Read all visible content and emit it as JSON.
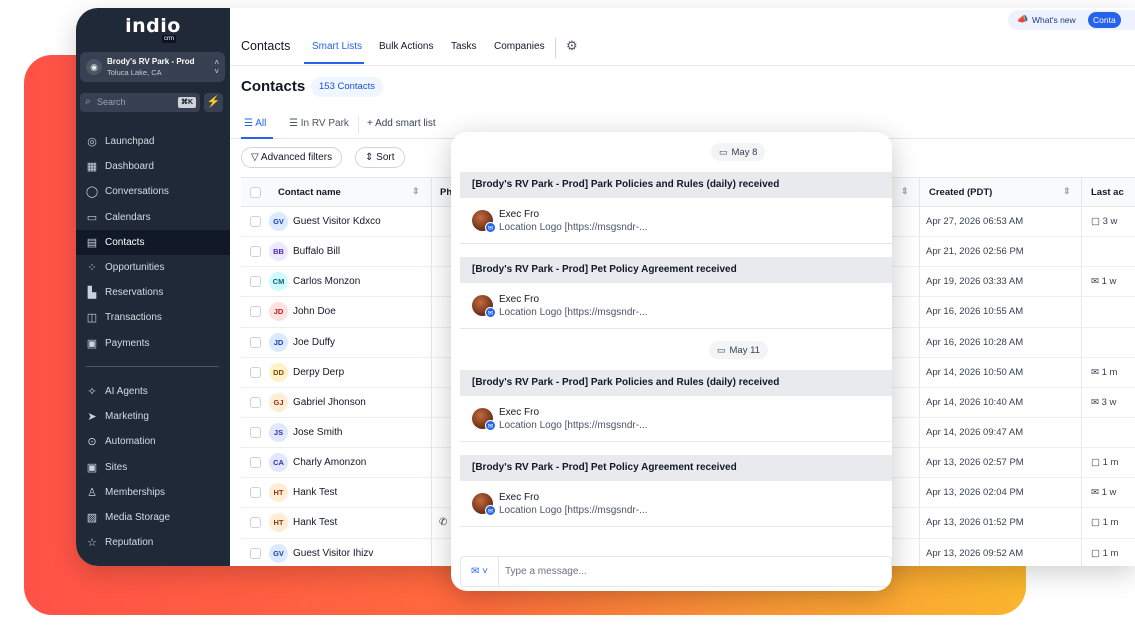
{
  "brand": {
    "logo_text": "indio",
    "logo_sub": "crm"
  },
  "location": {
    "name": "Brody's RV Park - Prod",
    "city": "Toluca Lake, CA"
  },
  "search": {
    "placeholder": "Search",
    "shortcut": "⌘K"
  },
  "sidebar": {
    "items": [
      {
        "label": "Launchpad",
        "icon": "rocket-icon",
        "glyph": "◎"
      },
      {
        "label": "Dashboard",
        "icon": "dashboard-icon",
        "glyph": "▦"
      },
      {
        "label": "Conversations",
        "icon": "chat-bubble-icon",
        "glyph": "◯"
      },
      {
        "label": "Calendars",
        "icon": "calendar-icon",
        "glyph": "▭"
      },
      {
        "label": "Contacts",
        "icon": "contacts-icon",
        "glyph": "▤",
        "active": true
      },
      {
        "label": "Opportunities",
        "icon": "opportunities-icon",
        "glyph": "⁘"
      },
      {
        "label": "Reservations",
        "icon": "reservations-icon",
        "glyph": "▙"
      },
      {
        "label": "Transactions",
        "icon": "transactions-icon",
        "glyph": "◫"
      },
      {
        "label": "Payments",
        "icon": "payments-icon",
        "glyph": "▣"
      }
    ],
    "items2": [
      {
        "label": "AI Agents",
        "icon": "sparkle-icon",
        "glyph": "✧"
      },
      {
        "label": "Marketing",
        "icon": "send-icon",
        "glyph": "➤"
      },
      {
        "label": "Automation",
        "icon": "automation-icon",
        "glyph": "⊙"
      },
      {
        "label": "Sites",
        "icon": "sites-icon",
        "glyph": "▣"
      },
      {
        "label": "Memberships",
        "icon": "membership-icon",
        "glyph": "♙"
      },
      {
        "label": "Media Storage",
        "icon": "media-icon",
        "glyph": "▨"
      },
      {
        "label": "Reputation",
        "icon": "star-icon",
        "glyph": "☆"
      }
    ]
  },
  "topnav": {
    "title": "Contacts",
    "tabs": [
      "Smart Lists",
      "Bulk Actions",
      "Tasks",
      "Companies"
    ],
    "whats_new": "What's new",
    "contact_btn": "Conta"
  },
  "page": {
    "title": "Contacts",
    "count": "153 Contacts"
  },
  "list_tabs": {
    "all": "All",
    "in_rv_park": "In RV Park",
    "add": "Add smart list"
  },
  "filters": {
    "advanced": "Advanced filters",
    "sort": "Sort"
  },
  "table": {
    "headers": {
      "name": "Contact name",
      "phone": "Ph",
      "created": "Created (PDT)",
      "last": "Last ac"
    },
    "rows": [
      {
        "initials": "GV",
        "name": "Guest Visitor Kdxco",
        "created": "Apr 27, 2026 06:53 AM",
        "last": "3 w",
        "last_icon": "chat"
      },
      {
        "initials": "BB",
        "name": "Buffalo Bill",
        "created": "Apr 21, 2026 02:56 PM",
        "last": "",
        "last_icon": ""
      },
      {
        "initials": "CM",
        "name": "Carlos Monzon",
        "created": "Apr 19, 2026 03:33 AM",
        "last": "1 w",
        "last_icon": "mail"
      },
      {
        "initials": "JD",
        "name": "John Doe",
        "created": "Apr 16, 2026 10:55 AM",
        "last": "",
        "last_icon": ""
      },
      {
        "initials": "JD",
        "name": "Joe Duffy",
        "created": "Apr 16, 2026 10:28 AM",
        "last": "",
        "last_icon": ""
      },
      {
        "initials": "DD",
        "name": "Derpy Derp",
        "created": "Apr 14, 2026 10:50 AM",
        "last": "1 m",
        "last_icon": "mail"
      },
      {
        "initials": "GJ",
        "name": "Gabriel Jhonson",
        "created": "Apr 14, 2026 10:40 AM",
        "last": "3 w",
        "last_icon": "mail"
      },
      {
        "initials": "JS",
        "name": "Jose Smith",
        "created": "Apr 14, 2026 09:47 AM",
        "last": "",
        "last_icon": ""
      },
      {
        "initials": "CA",
        "name": "Charly Amonzon",
        "created": "Apr 13, 2026 02:57 PM",
        "last": "1 m",
        "last_icon": "chat"
      },
      {
        "initials": "HT",
        "name": "Hank Test",
        "created": "Apr 13, 2026 02:04 PM",
        "last": "1 w",
        "last_icon": "mail"
      },
      {
        "initials": "HT",
        "name": "Hank Test",
        "created": "Apr 13, 2026 01:52 PM",
        "last": "1 m",
        "last_icon": "chat",
        "phone_icon": true
      },
      {
        "initials": "GV",
        "name": "Guest Visitor Ihizv",
        "created": "Apr 13, 2026 09:52 AM",
        "last": "1 m",
        "last_icon": "chat"
      }
    ]
  },
  "avatar_colors": {
    "GV": [
      "#dbeafe",
      "#1e40af"
    ],
    "BB": [
      "#ede9fe",
      "#5b21b6"
    ],
    "CM": [
      "#cffafe",
      "#155e75"
    ],
    "JD1": [
      "#fee2e2",
      "#b91c1c"
    ],
    "JD2": [
      "#dbeafe",
      "#1e40af"
    ],
    "DD": [
      "#fef3c7",
      "#92400e"
    ],
    "GJ": [
      "#ffedd5",
      "#9a3412"
    ],
    "JS": [
      "#e0e7ff",
      "#3730a3"
    ],
    "CA": [
      "#e0e7ff",
      "#3730a3"
    ],
    "HT": [
      "#ffedd5",
      "#9a3412"
    ]
  },
  "chat": {
    "dates": [
      "May 8",
      "May 11"
    ],
    "messages": [
      {
        "title": "[Brody's RV Park - Prod] Park Policies and Rules (daily) received",
        "sender": "Exec Fro",
        "preview": "Location Logo [https://msgsndr-..."
      },
      {
        "title": "[Brody's RV Park - Prod] Pet Policy Agreement received",
        "sender": "Exec Fro",
        "preview": "Location Logo [https://msgsndr-..."
      },
      {
        "title": "[Brody's RV Park - Prod] Park Policies and Rules (daily) received",
        "sender": "Exec Fro",
        "preview": "Location Logo [https://msgsndr-..."
      },
      {
        "title": "[Brody's RV Park - Prod] Pet Policy Agreement received",
        "sender": "Exec Fro",
        "preview": "Location Logo [https://msgsndr-..."
      }
    ],
    "composer_placeholder": "Type a message..."
  },
  "colors": {
    "accent": "#2563eb",
    "sidebar_bg": "#1f2937",
    "gradient_start": "#ff5247",
    "gradient_end": "#f9b62d"
  }
}
